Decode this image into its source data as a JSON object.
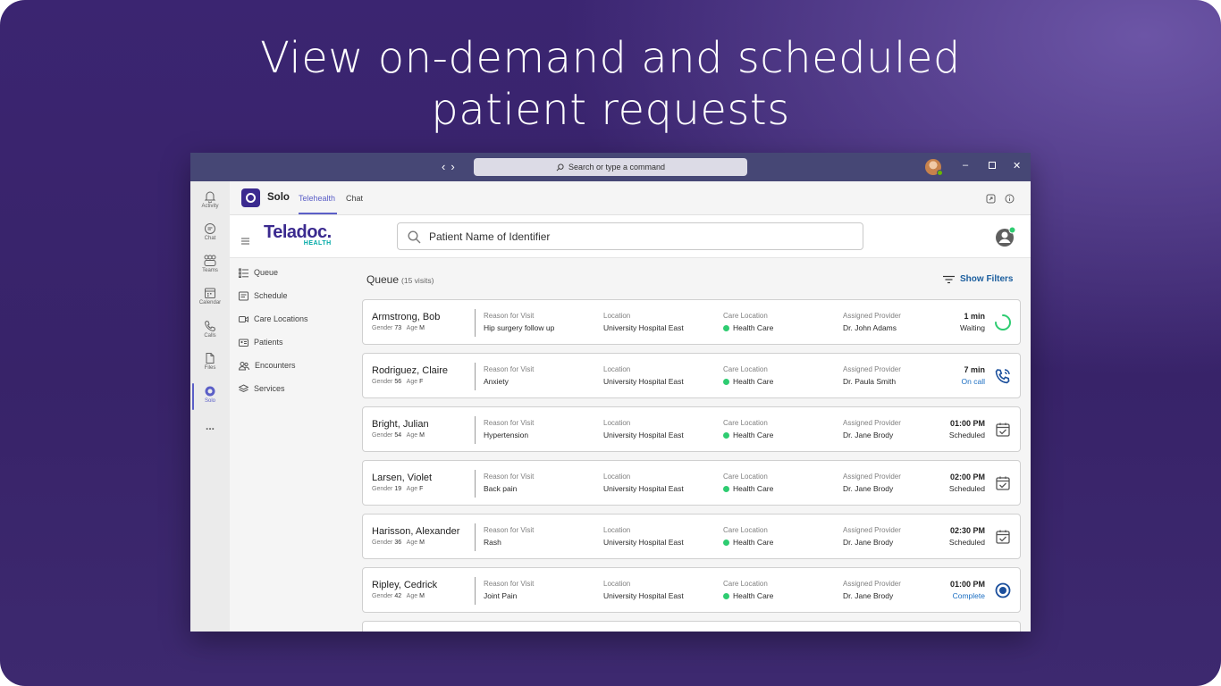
{
  "headline": {
    "line1": "View on-demand and scheduled",
    "line2": "patient requests"
  },
  "titlebar": {
    "search_placeholder": "Search or type a command"
  },
  "rail": [
    {
      "label": "Activity",
      "icon": "bell-icon"
    },
    {
      "label": "Chat",
      "icon": "chat-icon"
    },
    {
      "label": "Teams",
      "icon": "teams-icon"
    },
    {
      "label": "Calendar",
      "icon": "calendar-icon"
    },
    {
      "label": "Calls",
      "icon": "phone-icon"
    },
    {
      "label": "Files",
      "icon": "file-icon"
    },
    {
      "label": "Solo",
      "icon": "solo-icon"
    },
    {
      "label": "...",
      "icon": "more-icon"
    }
  ],
  "appbar": {
    "app_name": "Solo",
    "tabs": [
      "Telehealth",
      "Chat"
    ],
    "active_tab": "Telehealth"
  },
  "brand": {
    "name": "Teladoc.",
    "sub": "HEALTH"
  },
  "search": {
    "placeholder": "Patient Name of Identifier"
  },
  "sidenav": [
    {
      "label": "Queue",
      "icon": "list-icon"
    },
    {
      "label": "Schedule",
      "icon": "schedule-icon"
    },
    {
      "label": "Care Locations",
      "icon": "video-icon"
    },
    {
      "label": "Patients",
      "icon": "id-card-icon"
    },
    {
      "label": "Encounters",
      "icon": "people-icon"
    },
    {
      "label": "Services",
      "icon": "layers-icon"
    }
  ],
  "queue": {
    "title": "Queue",
    "count": "(15 visits)",
    "show_filters": "Show Filters",
    "labels": {
      "gender": "Gender",
      "age": "Age",
      "reason": "Reason for Visit",
      "location": "Location",
      "care_location": "Care Location",
      "provider": "Assigned Provider"
    },
    "visits": [
      {
        "name": "Armstrong, Bob",
        "gender": "73",
        "age": "M",
        "reason": "Hip surgery follow up",
        "location": "University Hospital East",
        "care_location": "Health Care",
        "provider": "Dr. John Adams",
        "time": "1 min",
        "status": "Waiting",
        "status_type": "waiting"
      },
      {
        "name": "Rodriguez, Claire",
        "gender": "56",
        "age": "F",
        "reason": "Anxiety",
        "location": "University Hospital East",
        "care_location": "Health Care",
        "provider": "Dr. Paula Smith",
        "time": "7 min",
        "status": "On call",
        "status_type": "oncall"
      },
      {
        "name": "Bright, Julian",
        "gender": "54",
        "age": "M",
        "reason": "Hypertension",
        "location": "University Hospital East",
        "care_location": "Health Care",
        "provider": "Dr. Jane Brody",
        "time": "01:00 PM",
        "status": "Scheduled",
        "status_type": "scheduled"
      },
      {
        "name": "Larsen, Violet",
        "gender": "19",
        "age": "F",
        "reason": "Back pain",
        "location": "University Hospital East",
        "care_location": "Health Care",
        "provider": "Dr. Jane Brody",
        "time": "02:00 PM",
        "status": "Scheduled",
        "status_type": "scheduled"
      },
      {
        "name": "Harisson, Alexander",
        "gender": "36",
        "age": "M",
        "reason": "Rash",
        "location": "University Hospital East",
        "care_location": "Health Care",
        "provider": "Dr. Jane Brody",
        "time": "02:30 PM",
        "status": "Scheduled",
        "status_type": "scheduled"
      },
      {
        "name": "Ripley, Cedrick",
        "gender": "42",
        "age": "M",
        "reason": "Joint Pain",
        "location": "University Hospital East",
        "care_location": "Health Care",
        "provider": "Dr. Jane Brody",
        "time": "01:00 PM",
        "status": "Complete",
        "status_type": "complete"
      }
    ]
  },
  "colors": {
    "background": "#3b2571",
    "titlebar": "#464775",
    "teams_accent": "#5b5fc7",
    "brand": "#3b2a8f",
    "status_green": "#2ecc71",
    "link_blue": "#1b6ec2"
  }
}
